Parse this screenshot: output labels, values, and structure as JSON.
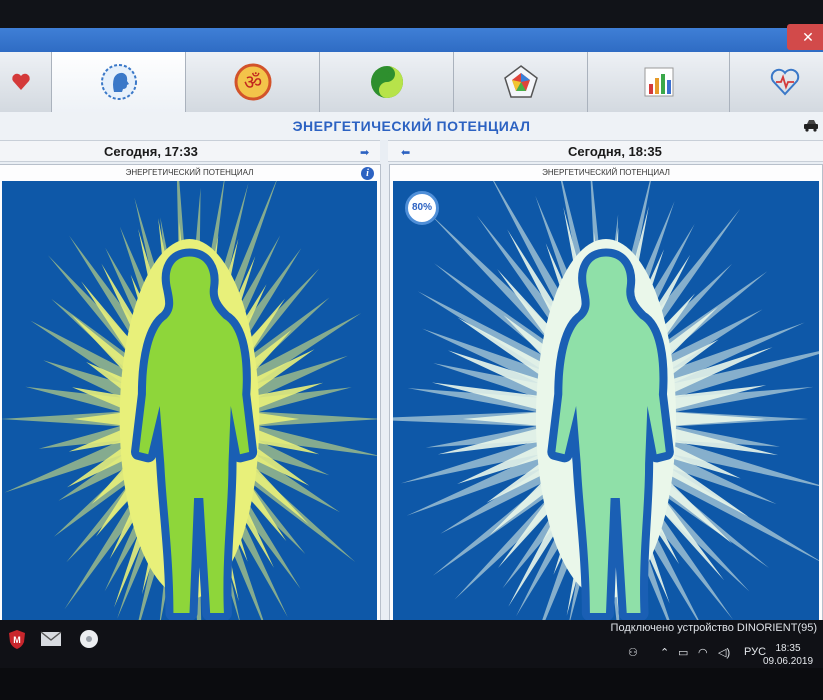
{
  "window": {
    "close_glyph": "✕",
    "accent": "#3f7fd6"
  },
  "toolbar": {
    "tabs": [
      {
        "icon": "heart-icon"
      },
      {
        "icon": "head-profile-icon",
        "active": true
      },
      {
        "icon": "om-icon"
      },
      {
        "icon": "yin-yang-icon"
      },
      {
        "icon": "chakra-pentagon-icon"
      },
      {
        "icon": "bar-chart-icon"
      },
      {
        "icon": "heart-pulse-icon"
      }
    ]
  },
  "main": {
    "title": "ЭНЕРГЕТИЧЕСКИЙ ПОТЕНЦИАЛ",
    "left": {
      "date": "Сегодня, 17:33",
      "panel_title": "ЭНЕРГЕТИЧЕСКИЙ ПОТЕНЦИАЛ",
      "info_glyph": "i",
      "aura_color": "#e8f07a",
      "body_color": "#8ed63a"
    },
    "right": {
      "date": "Сегодня, 18:35",
      "panel_title": "ЭНЕРГЕТИЧЕСКИЙ ПОТЕНЦИАЛ",
      "progress": "80%",
      "aura_color": "#eaf7ea",
      "body_color": "#8fe0a8"
    },
    "aura_background": "#1266b8"
  },
  "status": {
    "connection": "Подключено устройство DINORIENT(95)"
  },
  "taskbar": {
    "language": "РУС",
    "time": "18:35",
    "date": "09.06.2019"
  }
}
